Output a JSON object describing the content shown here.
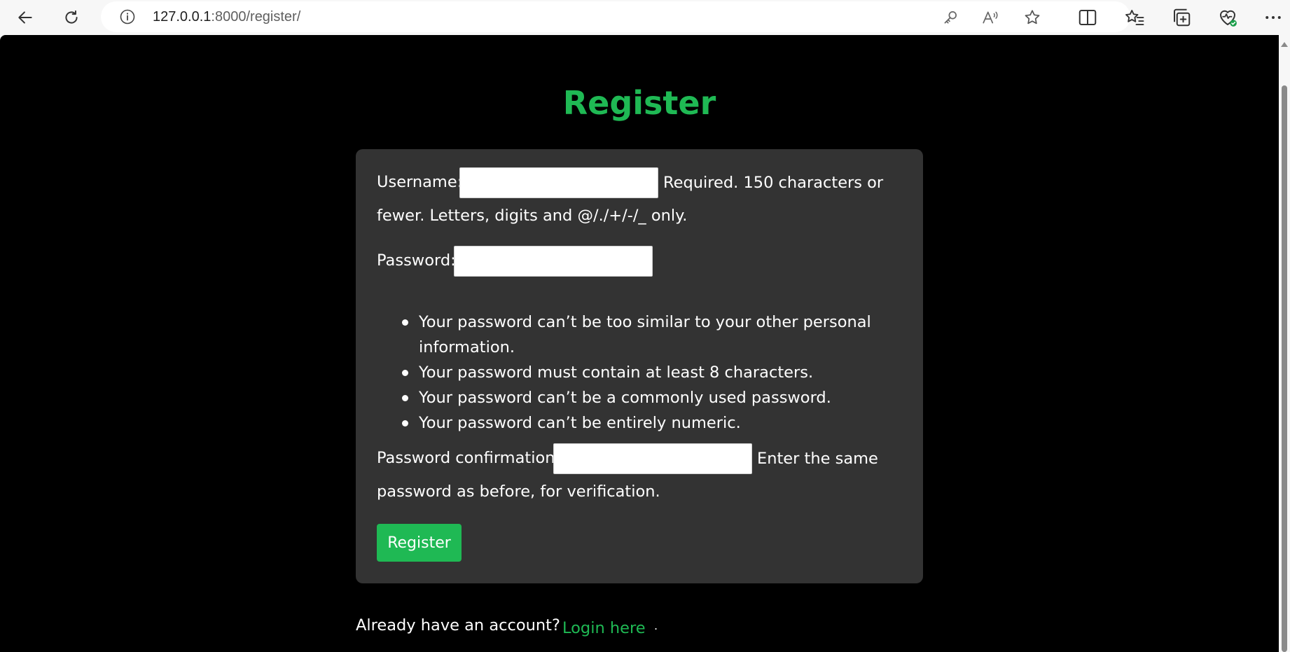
{
  "browser": {
    "url_host": "127.0.0.1",
    "url_path": ":8000/register/"
  },
  "page": {
    "title": "Register"
  },
  "form": {
    "username_label": "Username:",
    "username_value": "",
    "username_help_1": "Required. 150 characters or",
    "username_help_2": "fewer. Letters, digits and @/./+/-/_ only.",
    "password_label": "Password:",
    "password_value": "",
    "password_rules": [
      "Your password can’t be too similar to your other personal",
      "information.",
      "Your password must contain at least 8 characters.",
      "Your password can’t be a commonly used password.",
      "Your password can’t be entirely numeric."
    ],
    "confirm_label": "Password confirmation:",
    "confirm_value": "",
    "confirm_help_1": "Enter the same",
    "confirm_help_2": "password as before, for verification.",
    "submit_label": "Register"
  },
  "footer": {
    "prompt": "Already have an account?",
    "login_link": "Login here",
    "trailing": "."
  },
  "colors": {
    "accent": "#1fb954",
    "background": "#000000",
    "card": "#333333"
  }
}
